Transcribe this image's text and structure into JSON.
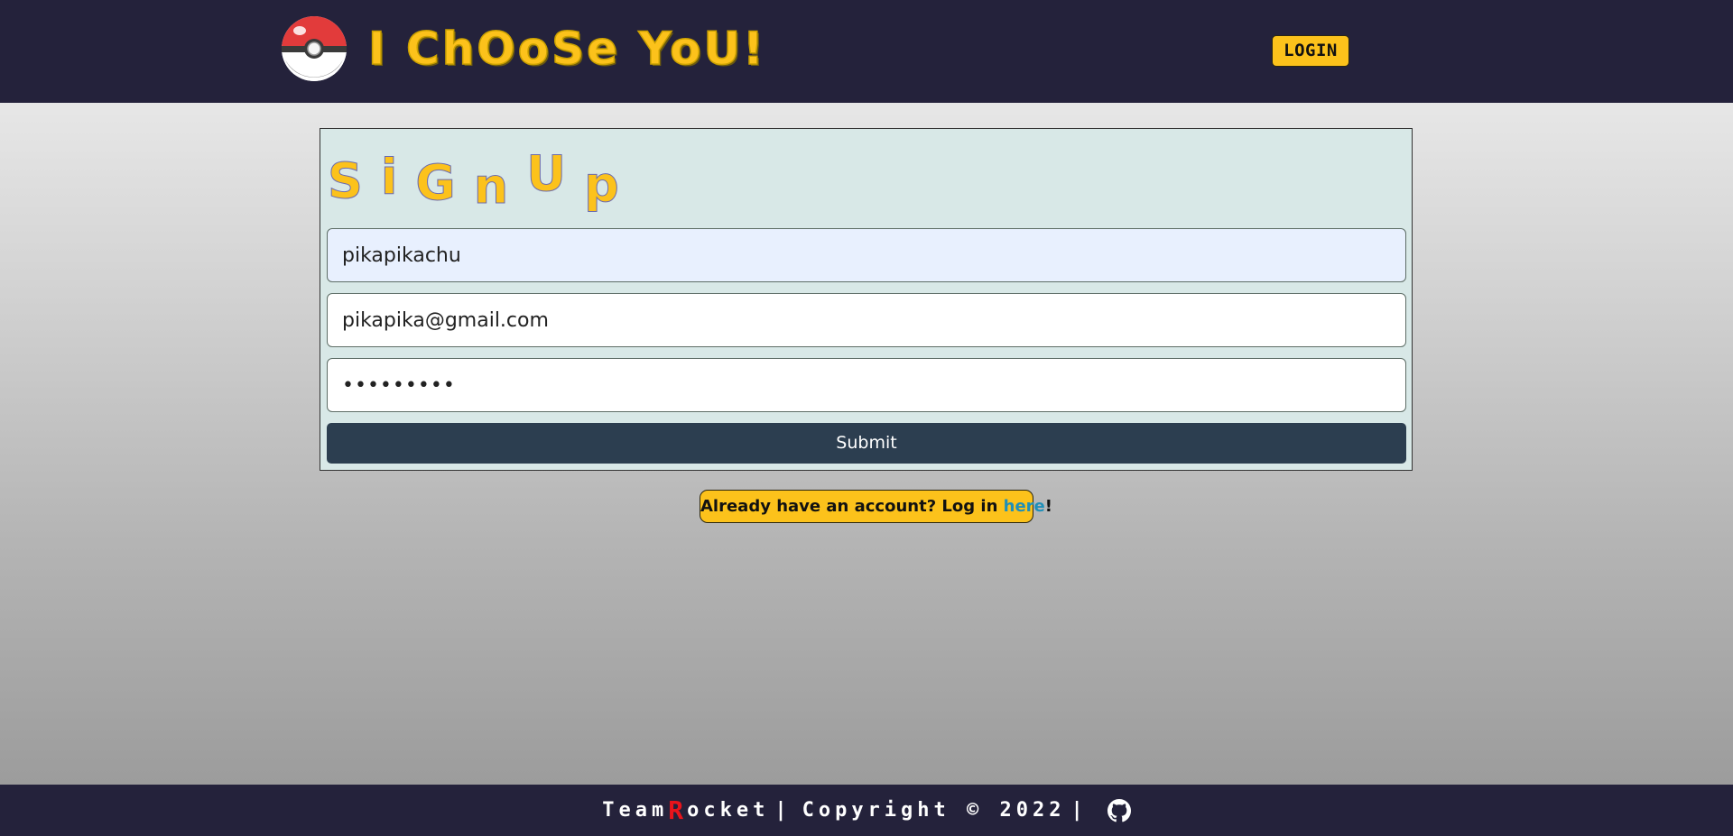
{
  "header": {
    "brand_title": "I ChOoSe YoU!",
    "login_label": "LOGIN"
  },
  "signup": {
    "title_letters": [
      "S",
      "i",
      "G",
      "n",
      "U",
      "p"
    ],
    "username_value": "pikapikachu",
    "email_value": "pikapika@gmail.com",
    "password_value": "•••••••••",
    "submit_label": "Submit"
  },
  "already": {
    "prefix": "Already have an account? Log in ",
    "link_label": "here",
    "suffix": "!"
  },
  "footer": {
    "team_prefix": "Team ",
    "team_r": "R",
    "team_suffix": "ocket",
    "divider": "|",
    "copyright": "Copyright © 2022",
    "icon": "github-icon"
  },
  "colors": {
    "header_bg": "#24223b",
    "accent_yellow": "#fcc21b",
    "submit_bg": "#2c3e50",
    "card_bg": "#d8e8e7",
    "link": "#1f8fb8",
    "rocket_r": "#e8141b"
  }
}
